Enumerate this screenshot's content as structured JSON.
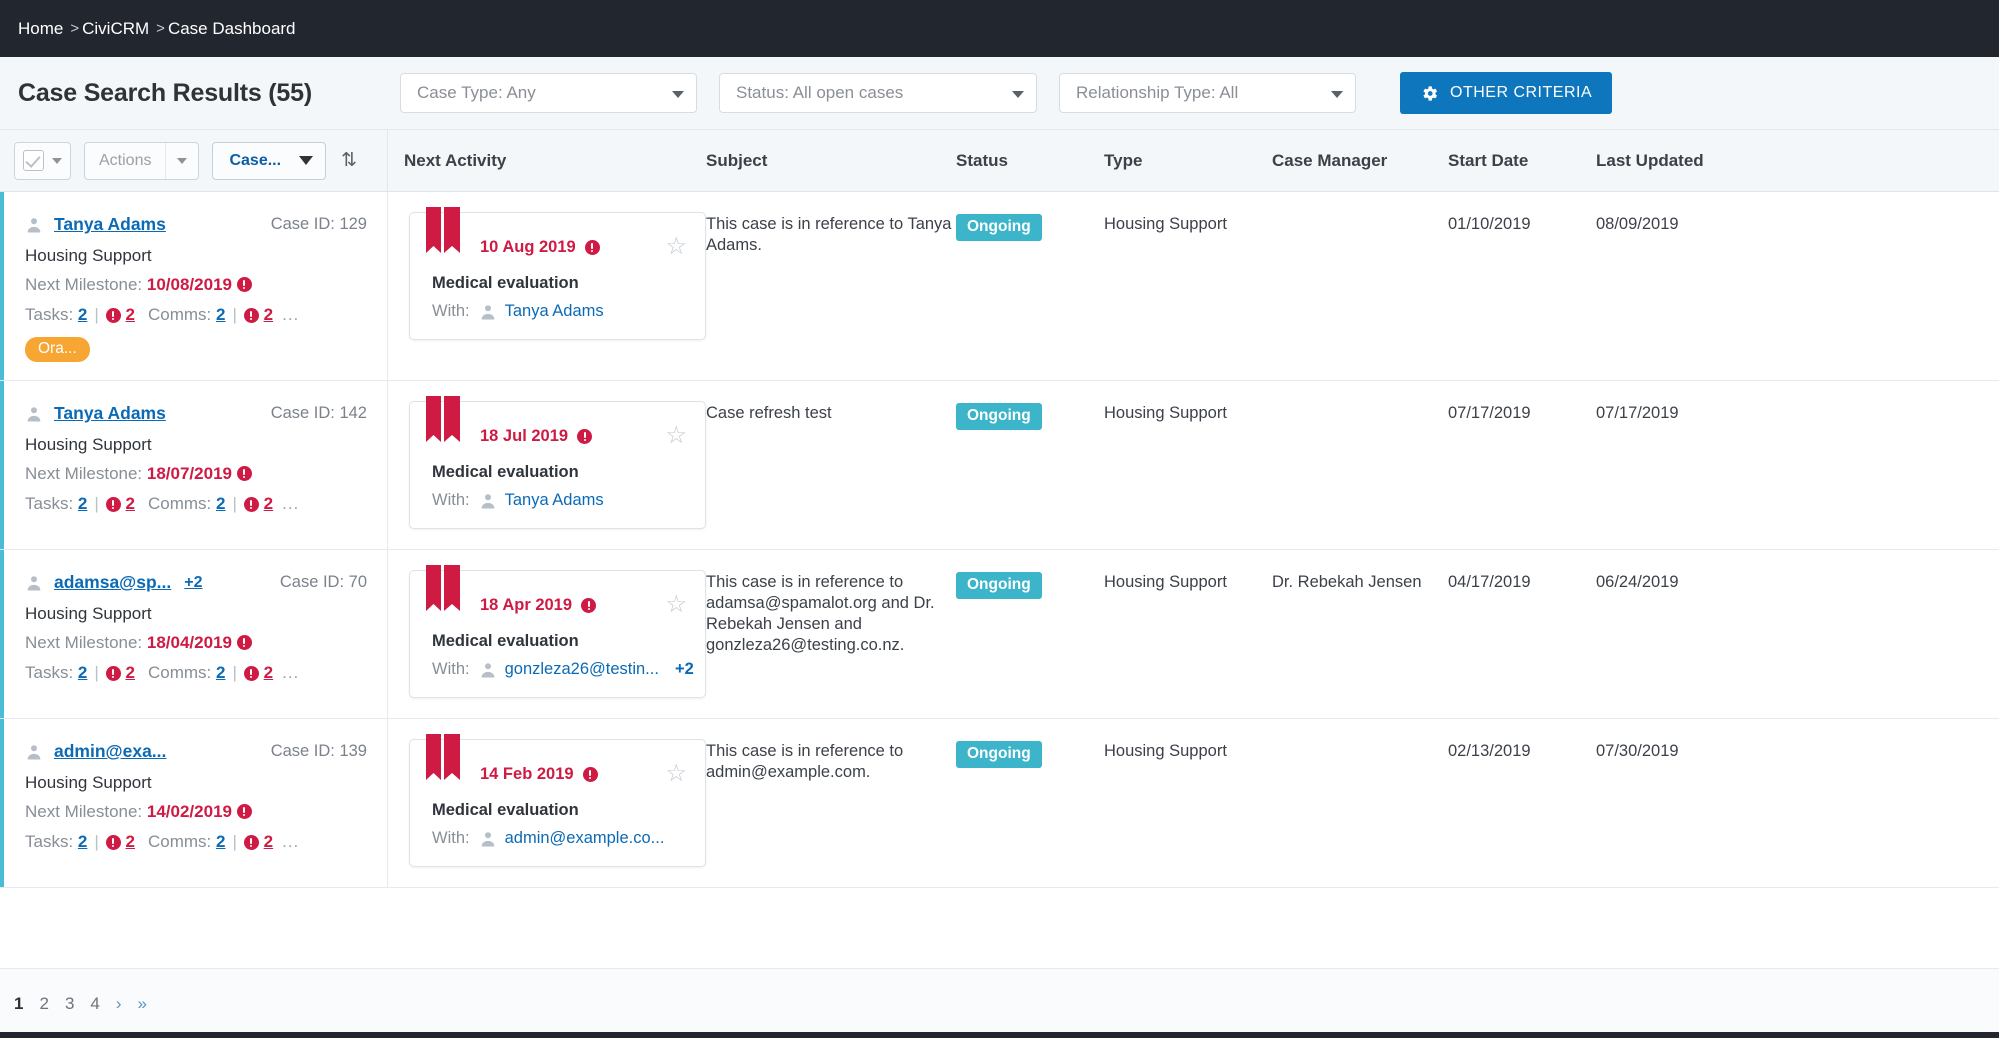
{
  "breadcrumb": {
    "items": [
      "Home",
      "CiviCRM",
      "Case Dashboard"
    ],
    "separator": ">"
  },
  "header": {
    "title": "Case Search Results (55)",
    "filters": [
      {
        "name": "case-type",
        "value": "Case Type: Any"
      },
      {
        "name": "status",
        "value": "Status: All open cases"
      },
      {
        "name": "relationship-type",
        "value": "Relationship Type: All"
      }
    ],
    "other_criteria_label": "OTHER CRITERIA",
    "gear_icon": "gear-icon",
    "primary_color": "#0e76bc"
  },
  "toolbar": {
    "select_all_icon": "checkbox-icon",
    "actions_label": "Actions",
    "case_label": "Case...",
    "sort_icon": "sort-icon"
  },
  "columns": [
    {
      "key": "next_activity",
      "label": "Next Activity"
    },
    {
      "key": "subject",
      "label": "Subject"
    },
    {
      "key": "status",
      "label": "Status"
    },
    {
      "key": "type",
      "label": "Type"
    },
    {
      "key": "case_manager",
      "label": "Case Manager"
    },
    {
      "key": "start_date",
      "label": "Start Date"
    },
    {
      "key": "last_updated",
      "label": "Last Updated"
    }
  ],
  "labels": {
    "case_id_prefix": "Case ID:",
    "next_milestone_prefix": "Next Milestone:",
    "tasks_prefix": "Tasks:",
    "comms_prefix": "Comms:",
    "with_prefix": "With:",
    "overflow_dots": "...",
    "pipe": "|"
  },
  "colors": {
    "accent_left_border": "#4bbcd6",
    "link": "#0b6ab5",
    "danger": "#cf1a44",
    "status_badge": "#3cb4c9",
    "tag_orange": "#f8a633"
  },
  "rows": [
    {
      "case": {
        "contact": "Tanya Adams",
        "extra_contacts": "",
        "case_id": "129",
        "case_type": "Housing Support",
        "next_milestone": "10/08/2019",
        "tasks_total": "2",
        "tasks_overdue": "2",
        "comms_total": "2",
        "comms_overdue": "2",
        "tag": "Ora..."
      },
      "activity": {
        "date": "10 Aug 2019",
        "subject": "Medical evaluation",
        "with": "Tanya Adams",
        "with_extra": "",
        "starred": false
      },
      "subject": "This case is in reference to Tanya Adams.",
      "status": "Ongoing",
      "type": "Housing Support",
      "case_manager": "",
      "start_date": "01/10/2019",
      "last_updated": "08/09/2019"
    },
    {
      "case": {
        "contact": "Tanya Adams",
        "extra_contacts": "",
        "case_id": "142",
        "case_type": "Housing Support",
        "next_milestone": "18/07/2019",
        "tasks_total": "2",
        "tasks_overdue": "2",
        "comms_total": "2",
        "comms_overdue": "2",
        "tag": ""
      },
      "activity": {
        "date": "18 Jul 2019",
        "subject": "Medical evaluation",
        "with": "Tanya Adams",
        "with_extra": "",
        "starred": false
      },
      "subject": "Case refresh test",
      "status": "Ongoing",
      "type": "Housing Support",
      "case_manager": "",
      "start_date": "07/17/2019",
      "last_updated": "07/17/2019"
    },
    {
      "case": {
        "contact": "adamsa@sp...",
        "extra_contacts": "+2",
        "case_id": "70",
        "case_type": "Housing Support",
        "next_milestone": "18/04/2019",
        "tasks_total": "2",
        "tasks_overdue": "2",
        "comms_total": "2",
        "comms_overdue": "2",
        "tag": ""
      },
      "activity": {
        "date": "18 Apr 2019",
        "subject": "Medical evaluation",
        "with": "gonzleza26@testin...",
        "with_extra": "+2",
        "starred": false
      },
      "subject": "This case is in reference to adamsa@spamalot.org and Dr. Rebekah Jensen and gonzleza26@testing.co.nz.",
      "status": "Ongoing",
      "type": "Housing Support",
      "case_manager": "Dr. Rebekah Jensen",
      "start_date": "04/17/2019",
      "last_updated": "06/24/2019"
    },
    {
      "case": {
        "contact": "admin@exa...",
        "extra_contacts": "",
        "case_id": "139",
        "case_type": "Housing Support",
        "next_milestone": "14/02/2019",
        "tasks_total": "2",
        "tasks_overdue": "2",
        "comms_total": "2",
        "comms_overdue": "2",
        "tag": ""
      },
      "activity": {
        "date": "14 Feb 2019",
        "subject": "Medical evaluation",
        "with": "admin@example.co...",
        "with_extra": "",
        "starred": false
      },
      "subject": "This case is in reference to admin@example.com.",
      "status": "Ongoing",
      "type": "Housing Support",
      "case_manager": "",
      "start_date": "02/13/2019",
      "last_updated": "07/30/2019"
    }
  ],
  "pagination": {
    "pages": [
      "1",
      "2",
      "3",
      "4"
    ],
    "current": "1",
    "next": "›",
    "last": "»"
  }
}
